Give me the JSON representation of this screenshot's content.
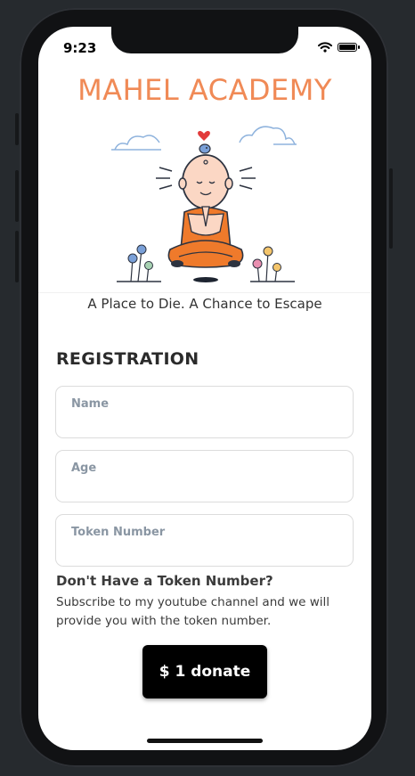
{
  "status_bar": {
    "time": "9:23"
  },
  "app": {
    "title": "MAHEL ACADEMY",
    "tagline": "A Place to Die. A Chance to Escape",
    "accent_color": "#f08a56"
  },
  "form": {
    "heading": "REGISTRATION",
    "fields": [
      {
        "label": "Name",
        "value": ""
      },
      {
        "label": "Age",
        "value": ""
      },
      {
        "label": "Token Number",
        "value": ""
      }
    ]
  },
  "token_help": {
    "title": "Don't Have a Token Number?",
    "text": "Subscribe to my youtube channel and we will provide you with the token number."
  },
  "donate_button": {
    "label": "$ 1 donate"
  },
  "icons": {
    "wifi": "wifi-icon",
    "battery": "battery-icon",
    "illustration": "meditating-monk-illustration"
  }
}
